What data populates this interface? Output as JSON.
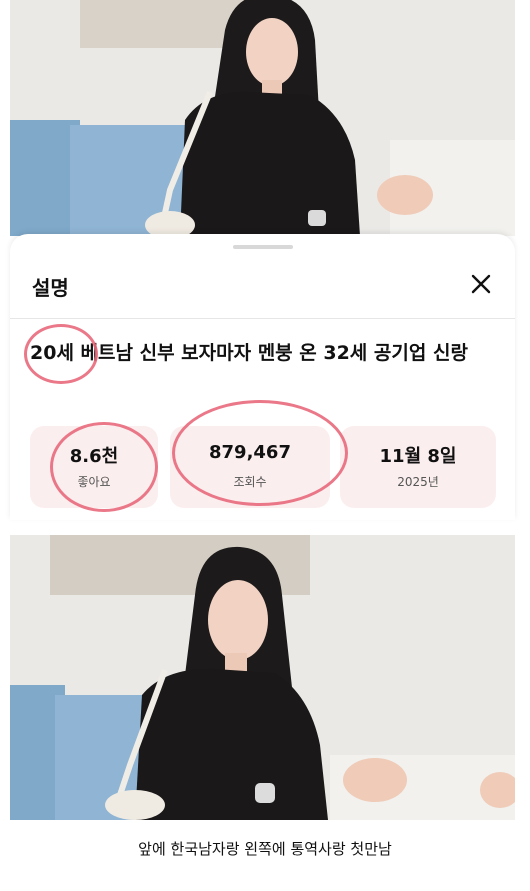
{
  "sheet": {
    "title": "설명",
    "close_icon": "close-icon",
    "video_title_prefix": "20세",
    "video_title_rest": " 베트남 신부 보자마자 멘붕 온 32세 공기업 신랑"
  },
  "stats": {
    "likes": {
      "value": "8.6천",
      "label": "좋아요"
    },
    "views": {
      "value": "879,467",
      "label": "조회수"
    },
    "date": {
      "value": "11월 8일",
      "label": "2025년"
    }
  },
  "caption": "앞에 한국남자랑 왼쪽에 통역사랑 첫만남",
  "colors": {
    "stat_bg": "#fbeeee",
    "annotation_circle": "#e8697b"
  }
}
